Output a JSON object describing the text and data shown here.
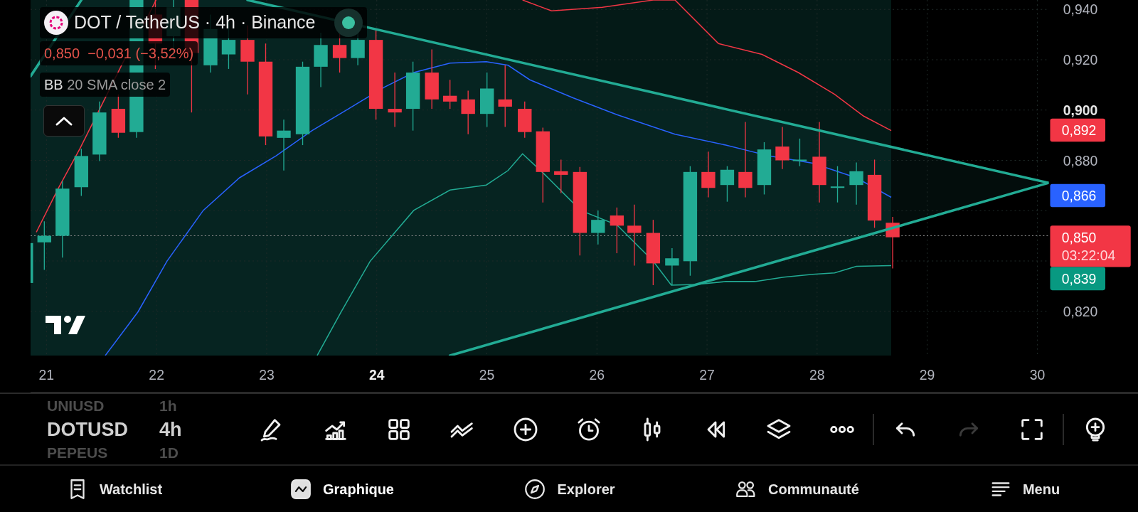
{
  "symbol": {
    "title": "DOT / TetherUS · 4h · Binance",
    "live": true
  },
  "quote": {
    "price": "0,850",
    "change": "−0,031 (−3,52%)",
    "falling": true
  },
  "indicator": {
    "name": "BB",
    "params": "20 SMA close 2"
  },
  "price_axis": [
    {
      "label": "0,940",
      "bold": false
    },
    {
      "label": "0,920",
      "bold": false
    },
    {
      "label": "0,900",
      "bold": true
    },
    {
      "label": "0,880",
      "bold": false
    },
    {
      "label": "0,820",
      "bold": false
    }
  ],
  "price_labels": [
    {
      "text": "0,892",
      "color": "#f23645"
    },
    {
      "text": "0,866",
      "color": "#2962ff"
    },
    {
      "text": "0,850",
      "countdown": "03:22:04",
      "color": "#f23645"
    },
    {
      "text": "0,839",
      "color": "#089981"
    }
  ],
  "date_axis": [
    {
      "label": "21",
      "bold": false
    },
    {
      "label": "22",
      "bold": false
    },
    {
      "label": "23",
      "bold": false
    },
    {
      "label": "24",
      "bold": true
    },
    {
      "label": "25",
      "bold": false
    },
    {
      "label": "26",
      "bold": false
    },
    {
      "label": "27",
      "bold": false
    },
    {
      "label": "28",
      "bold": false
    },
    {
      "label": "29",
      "bold": false
    },
    {
      "label": "30",
      "bold": false
    }
  ],
  "watchlist_picker": [
    {
      "symbol": "UNIUSD",
      "interval": "1h",
      "selected": false
    },
    {
      "symbol": "DOTUSD",
      "interval": "4h",
      "selected": true
    },
    {
      "symbol": "PEPEUS",
      "interval": "1D",
      "selected": false
    }
  ],
  "tools": [
    {
      "kind": "draw",
      "disabled": false
    },
    {
      "kind": "indicators",
      "disabled": false
    },
    {
      "kind": "layouts",
      "disabled": false
    },
    {
      "kind": "patterns",
      "disabled": false
    },
    {
      "kind": "add",
      "disabled": false
    },
    {
      "kind": "alert",
      "disabled": false
    },
    {
      "kind": "chart-type",
      "disabled": false
    },
    {
      "kind": "replay",
      "disabled": false
    },
    {
      "kind": "objects",
      "disabled": false
    },
    {
      "kind": "more",
      "disabled": false
    },
    {
      "kind": "undo",
      "disabled": false
    },
    {
      "kind": "redo",
      "disabled": true
    },
    {
      "kind": "fullscreen",
      "disabled": false
    },
    {
      "kind": "ideas",
      "disabled": false
    }
  ],
  "nav": [
    {
      "kind": "watchlist",
      "label": "Watchlist",
      "selected": false
    },
    {
      "kind": "chart",
      "label": "Graphique",
      "selected": true
    },
    {
      "kind": "explore",
      "label": "Explorer",
      "selected": false
    },
    {
      "kind": "community",
      "label": "Communauté",
      "selected": false
    },
    {
      "kind": "menu",
      "label": "Menu",
      "selected": false
    }
  ]
}
